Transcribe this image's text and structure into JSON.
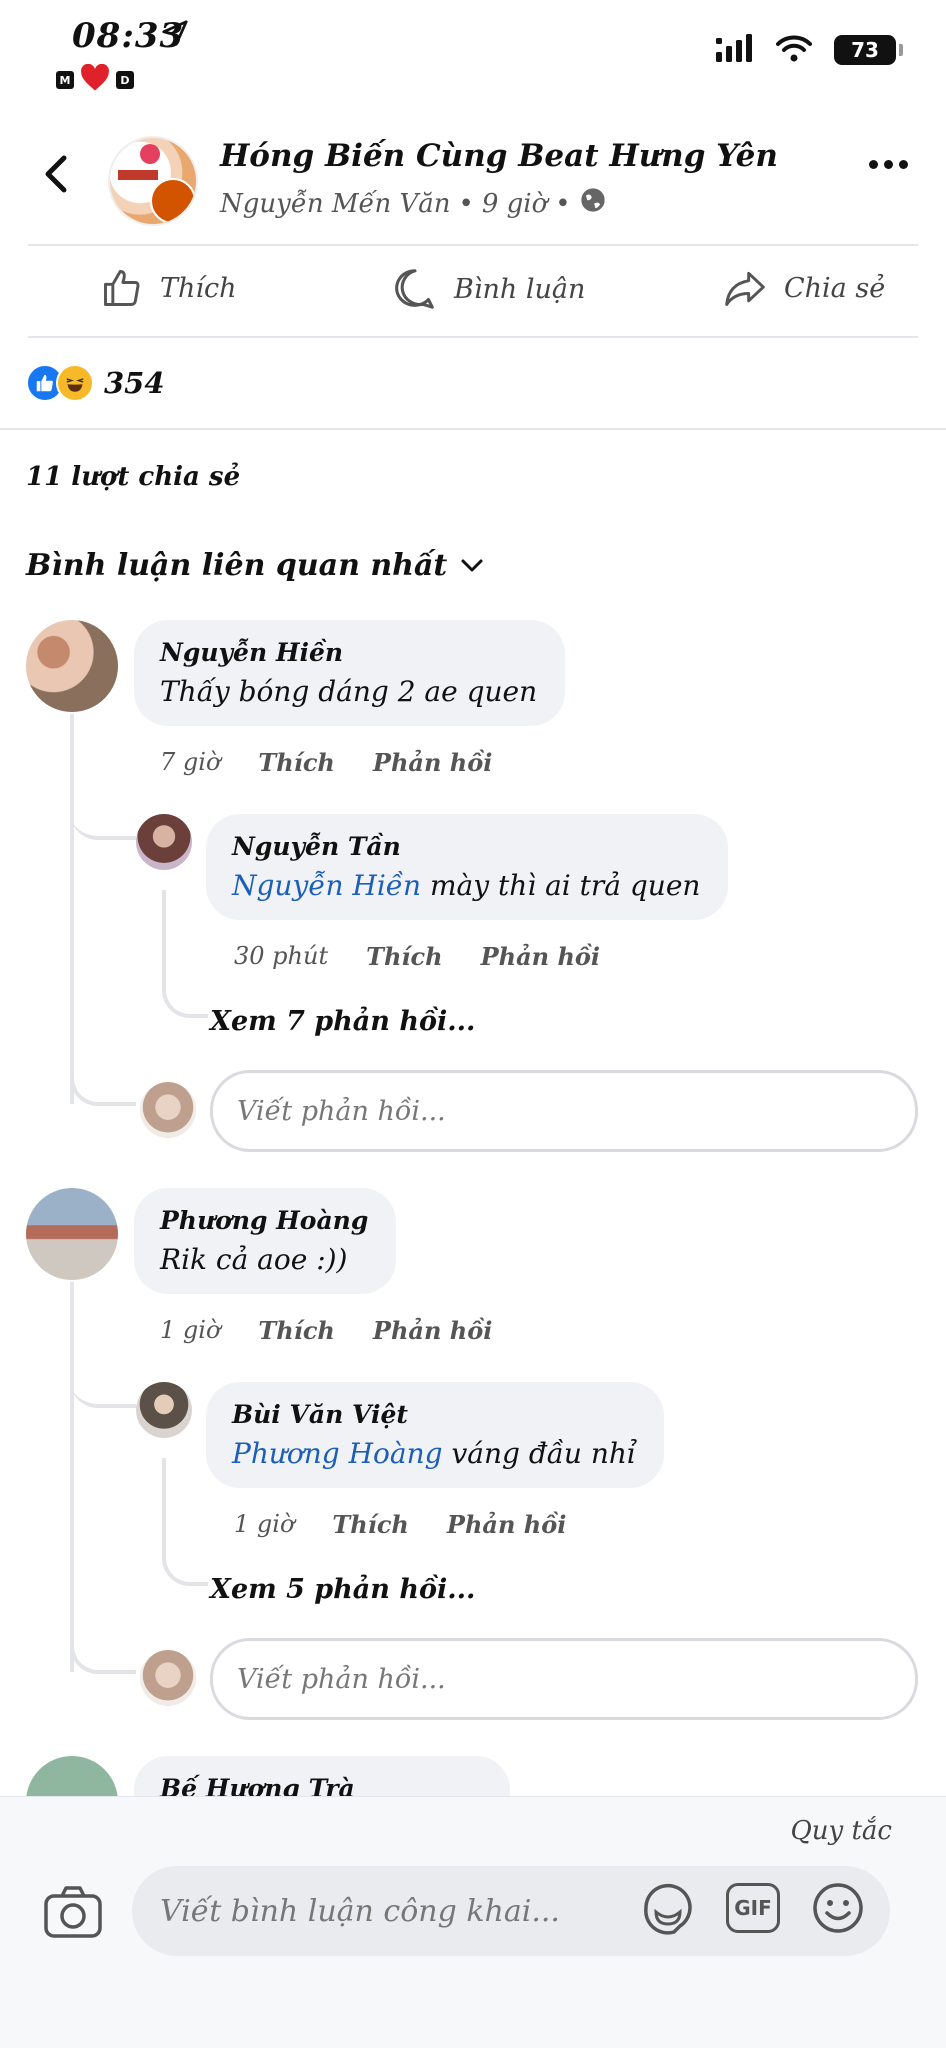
{
  "status": {
    "time": "08:33",
    "badge_left": "M",
    "badge_right": "D",
    "battery": "73"
  },
  "header": {
    "group_name": "Hóng Biến Cùng Beat Hưng Yên",
    "author": "Nguyễn Mến Văn",
    "sep": "•",
    "time": "9 giờ",
    "audience_icon": "globe-icon"
  },
  "actions": {
    "like": "Thích",
    "comment": "Bình luận",
    "share": "Chia sẻ"
  },
  "reactions": {
    "count": "354",
    "types": [
      "like",
      "haha"
    ]
  },
  "shares": "11 lượt chia sẻ",
  "sort_label": "Bình luận liên quan nhất",
  "comments": [
    {
      "name": "Nguyễn Hiền",
      "text": "Thấy bóng dáng 2 ae quen",
      "time": "7 giờ",
      "like": "Thích",
      "reply": "Phản hồi",
      "replies": [
        {
          "name": "Nguyễn Tần",
          "mention": "Nguyễn Hiền",
          "text": " mày thì ai trả quen",
          "time": "30 phút",
          "like": "Thích",
          "reply": "Phản hồi"
        }
      ],
      "view_more": "Xem 7 phản hồi...",
      "reply_placeholder": "Viết phản hồi..."
    },
    {
      "name": "Phương Hoàng",
      "text": "Rik cả aoe :))",
      "time": "1 giờ",
      "like": "Thích",
      "reply": "Phản hồi",
      "replies": [
        {
          "name": "Bùi Văn Việt",
          "mention": "Phương Hoàng",
          "text": " váng đầu nhỉ",
          "time": "1 giờ",
          "like": "Thích",
          "reply": "Phản hồi"
        }
      ],
      "view_more": "Xem 5 phản hồi...",
      "reply_placeholder": "Viết phản hồi..."
    },
    {
      "name": "Bế Hương Trà"
    }
  ],
  "composer": {
    "rules": "Quy tắc",
    "placeholder": "Viết bình luận công khai...",
    "gif": "GIF"
  },
  "colors": {
    "accent": "#1877f2",
    "mention": "#1b5fb8",
    "bubble": "#f0f2f5",
    "haha": "#f7b928"
  }
}
